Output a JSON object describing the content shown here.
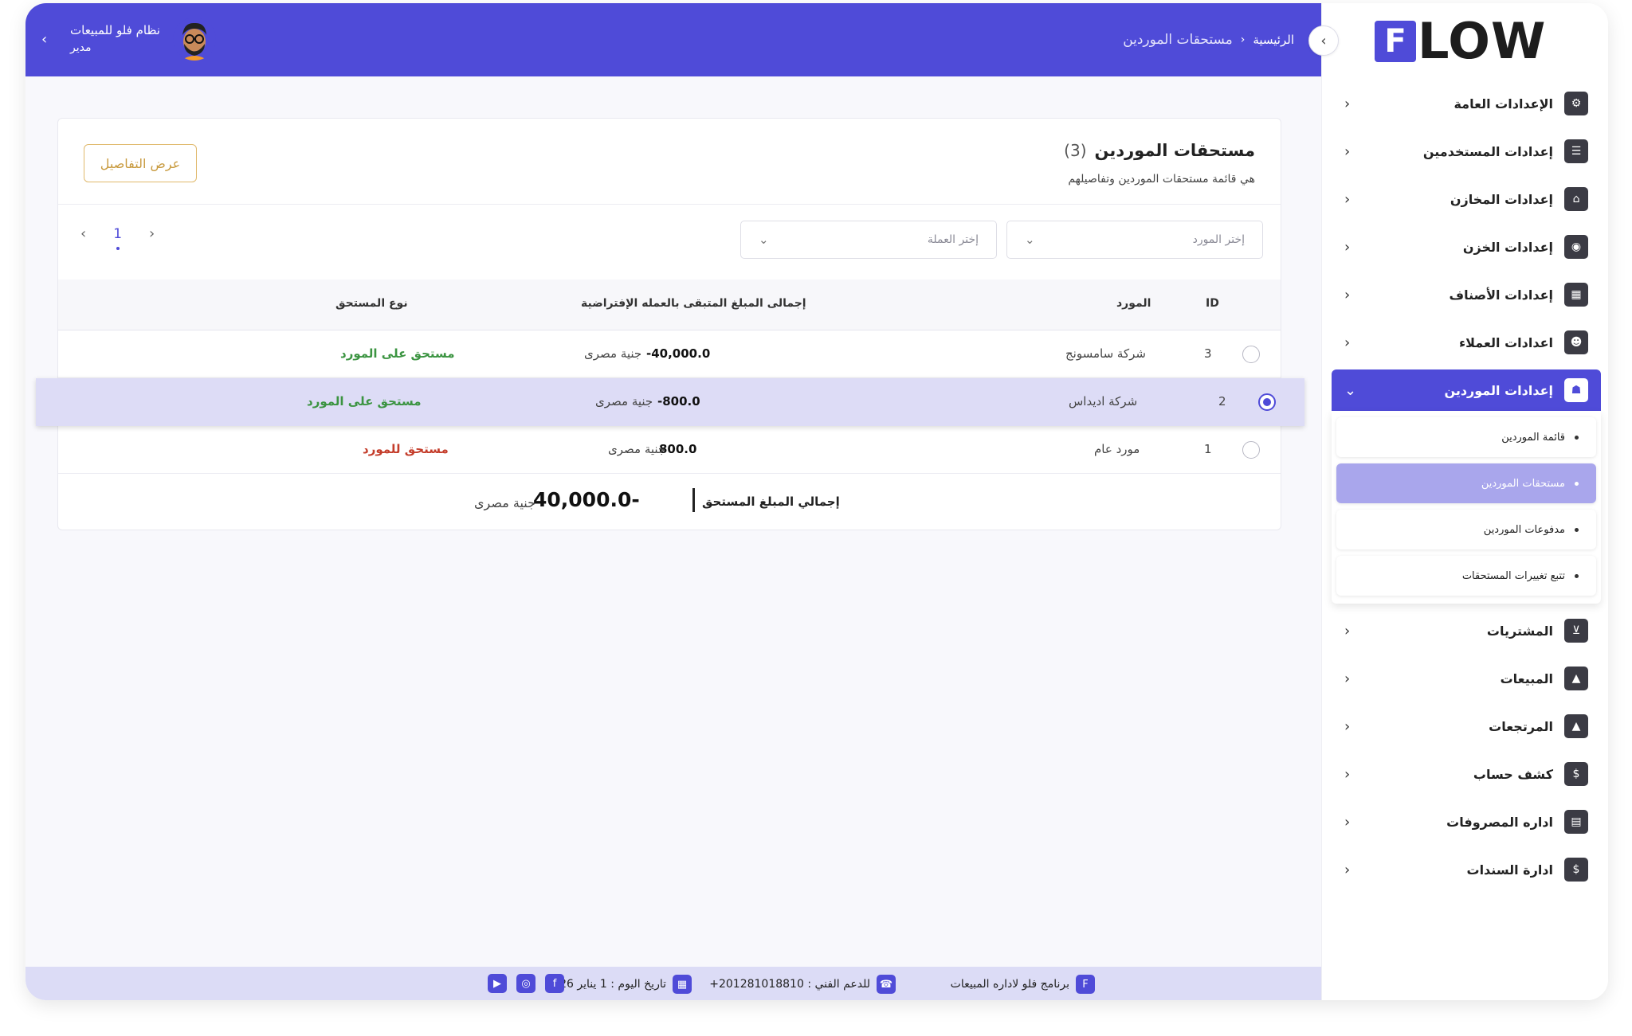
{
  "header": {
    "user_name": "نظام فلو للمبيعات",
    "user_role": "مدير",
    "breadcrumb_home": "الرئيسية",
    "breadcrumb_current": "مستحقات الموردين"
  },
  "card": {
    "title": "مستحقات الموردين",
    "count": "(3)",
    "subtitle": "هي قائمة مستحقات الموردين وتفاصيلهم",
    "details_button": "عرض التفاصيل"
  },
  "filters": {
    "supplier_placeholder": "إختر المورد",
    "currency_placeholder": "إختر العملة"
  },
  "pagination": {
    "current_page": "1"
  },
  "table": {
    "headers": {
      "id": "ID",
      "supplier": "المورد",
      "total": "إجمالى المبلغ المتبقى بالعمله الإفتراضية",
      "type": "نوع المستحق"
    },
    "rows": [
      {
        "id": "3",
        "supplier": "شركة سامسونج",
        "amount": "40,000.0-",
        "currency": "جنية مصرى",
        "type": "مستحق على المورد",
        "selected": false
      },
      {
        "id": "2",
        "supplier": "شركة اديداس",
        "amount": "800.0-",
        "currency": "جنية مصرى",
        "type": "مستحق على المورد",
        "selected": true
      },
      {
        "id": "1",
        "supplier": "مورد عام",
        "amount": "800.0",
        "currency": "جنية مصرى",
        "type": "مستحق للمورد",
        "selected": false
      }
    ],
    "total_label": "إجمالي المبلغ المستحق",
    "total_value": "40,000.0-",
    "total_currency": "جنية مصرى"
  },
  "footer": {
    "app_name": "برنامج فلو لاداره المبيعات",
    "support": "للدعم الفني : 201281018810+",
    "date": "تاريخ اليوم : 1 يناير 2026"
  },
  "sidebar": {
    "logo_text": "LOW",
    "items": [
      {
        "label": "الإعدادات العامة",
        "icon": "gear-icon"
      },
      {
        "label": "إعدادات المستخدمين",
        "icon": "user-card-icon"
      },
      {
        "label": "إعدادات المخازن",
        "icon": "store-icon"
      },
      {
        "label": "إعدادات الخزن",
        "icon": "safe-icon"
      },
      {
        "label": "إعدادات الأصناف",
        "icon": "grid-icon"
      },
      {
        "label": "اعدادات العملاء",
        "icon": "users-icon"
      },
      {
        "label": "إعدادات الموردين",
        "icon": "supplier-icon"
      },
      {
        "label": "المشتريات",
        "icon": "cart-icon"
      },
      {
        "label": "المبيعات",
        "icon": "chart-icon"
      },
      {
        "label": "المرتجعات",
        "icon": "chart-icon"
      },
      {
        "label": "كشف حساب",
        "icon": "statement-icon"
      },
      {
        "label": "اداره المصروفات",
        "icon": "calculator-icon"
      },
      {
        "label": "ادارة السندات",
        "icon": "voucher-icon"
      }
    ],
    "submenu": [
      {
        "label": "قائمة الموردين"
      },
      {
        "label": "مستحقات الموردين"
      },
      {
        "label": "مدفوعات الموردين"
      },
      {
        "label": "تتبع تغييرات المستحقات"
      }
    ]
  },
  "colors": {
    "primary": "#4f4bd8",
    "selected_row": "#dddcf6",
    "green": "#3b9441",
    "red": "#c43d2b",
    "gold": "#c89a3e"
  }
}
